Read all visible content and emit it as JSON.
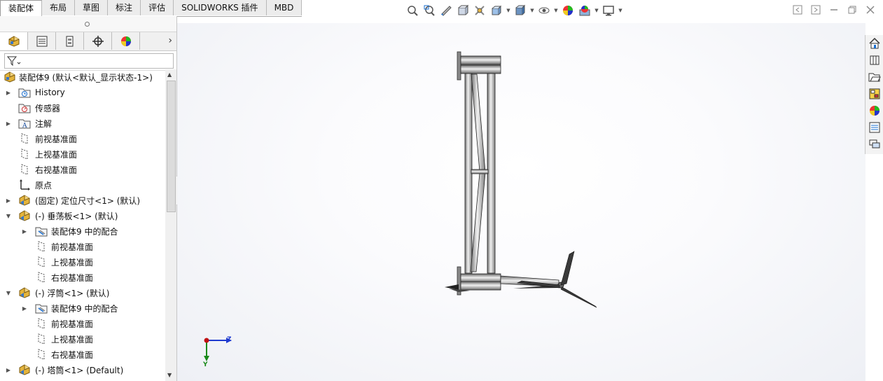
{
  "command_tabs": [
    {
      "label": "装配体",
      "active": true
    },
    {
      "label": "布局"
    },
    {
      "label": "草图"
    },
    {
      "label": "标注"
    },
    {
      "label": "评估"
    },
    {
      "label": "SOLIDWORKS 插件"
    },
    {
      "label": "MBD"
    }
  ],
  "tree": {
    "root": "装配体9  (默认<默认_显示状态-1>)",
    "items": [
      {
        "label": "History"
      },
      {
        "label": "传感器"
      },
      {
        "label": "注解"
      },
      {
        "label": "前视基准面"
      },
      {
        "label": "上视基准面"
      },
      {
        "label": "右视基准面"
      },
      {
        "label": "原点"
      },
      {
        "label": "(固定) 定位尺寸<1> (默认)"
      },
      {
        "label": "(-) 垂荡板<1> (默认)"
      },
      {
        "label": "装配体9 中的配合"
      },
      {
        "label": "前视基准面"
      },
      {
        "label": "上视基准面"
      },
      {
        "label": "右视基准面"
      },
      {
        "label": "(-) 浮筒<1> (默认)"
      },
      {
        "label": "装配体9 中的配合"
      },
      {
        "label": "前视基准面"
      },
      {
        "label": "上视基准面"
      },
      {
        "label": "右视基准面"
      },
      {
        "label": "(-) 塔筒<1> (Default)"
      }
    ]
  },
  "triad": {
    "z_label": "Z",
    "y_label": "Y"
  },
  "colors": {
    "accent": "#1a6fd1",
    "frame_metal": "#c9c9c9",
    "triad_z": "#1f3bd0",
    "triad_y": "#1a8a1a",
    "triad_x": "#c01010"
  }
}
